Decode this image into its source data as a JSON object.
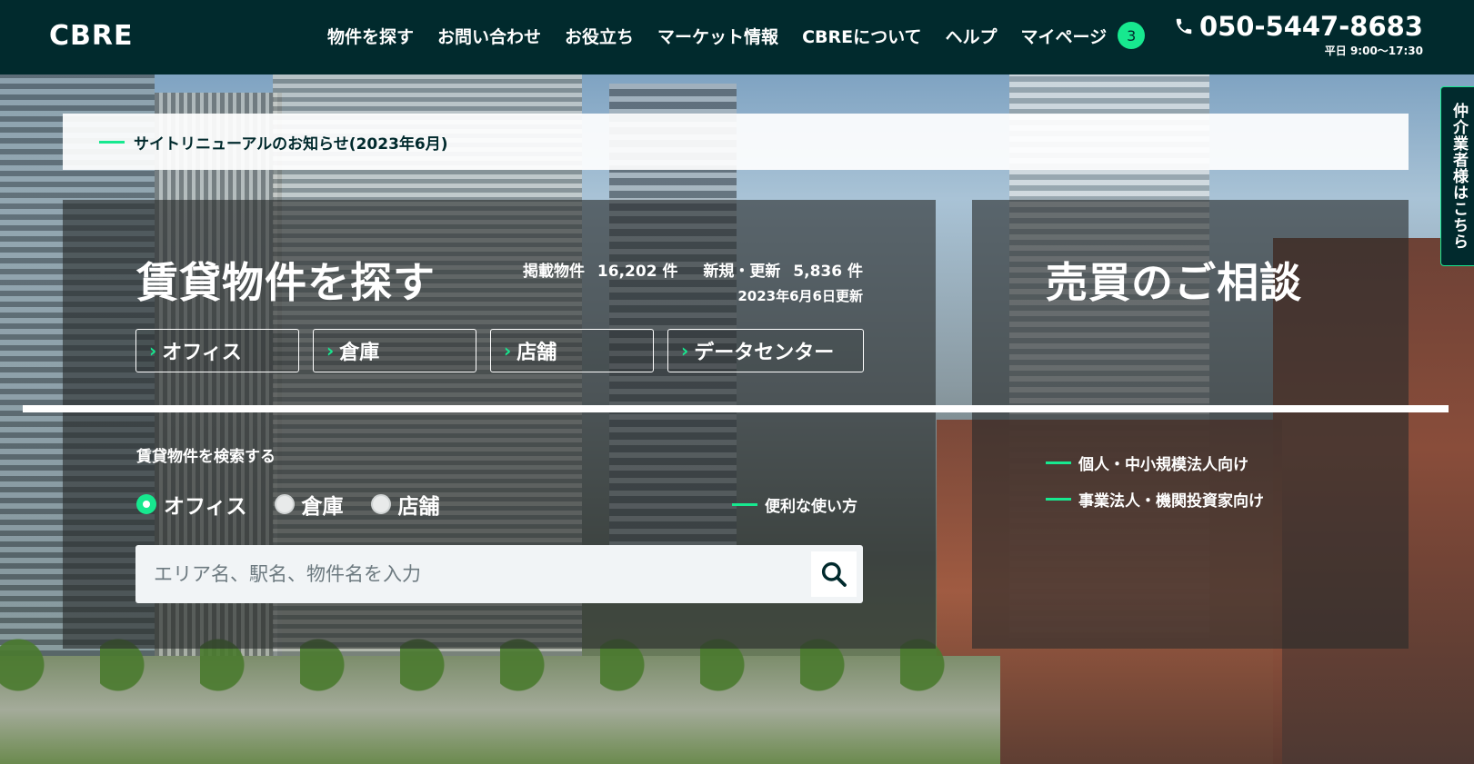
{
  "header": {
    "logo": "CBRE",
    "nav": [
      "物件を探す",
      "お問い合わせ",
      "お役立ち",
      "マーケット情報",
      "CBREについて",
      "ヘルプ",
      "マイページ"
    ],
    "mypage_badge": "3",
    "phone": "050-5447-8683",
    "phone_hours": "平日 9:00〜17:30"
  },
  "notice": {
    "text": "サイトリニューアルのお知らせ(2023年6月)"
  },
  "rent": {
    "title": "賃貸物件を探す",
    "listed_label": "掲載物件",
    "listed_count": "16,202 件",
    "updated_label": "新規・更新",
    "updated_count": "5,836 件",
    "updated_date": "2023年6月6日更新",
    "categories": [
      "オフィス",
      "倉庫",
      "店舗",
      "データセンター"
    ],
    "search_label": "賃貸物件を検索する",
    "radio_options": [
      "オフィス",
      "倉庫",
      "店舗"
    ],
    "radio_selected": "オフィス",
    "usage_link": "便利な使い方",
    "search_placeholder": "エリア名、駅名、物件名を入力"
  },
  "sale": {
    "title": "売買のご相談",
    "links": [
      "個人・中小規模法人向け",
      "事業法人・機関投資家向け"
    ]
  },
  "broker_tab": "仲介業者様はこちら",
  "colors": {
    "header_bg": "#012a2d",
    "accent": "#17e88f"
  }
}
